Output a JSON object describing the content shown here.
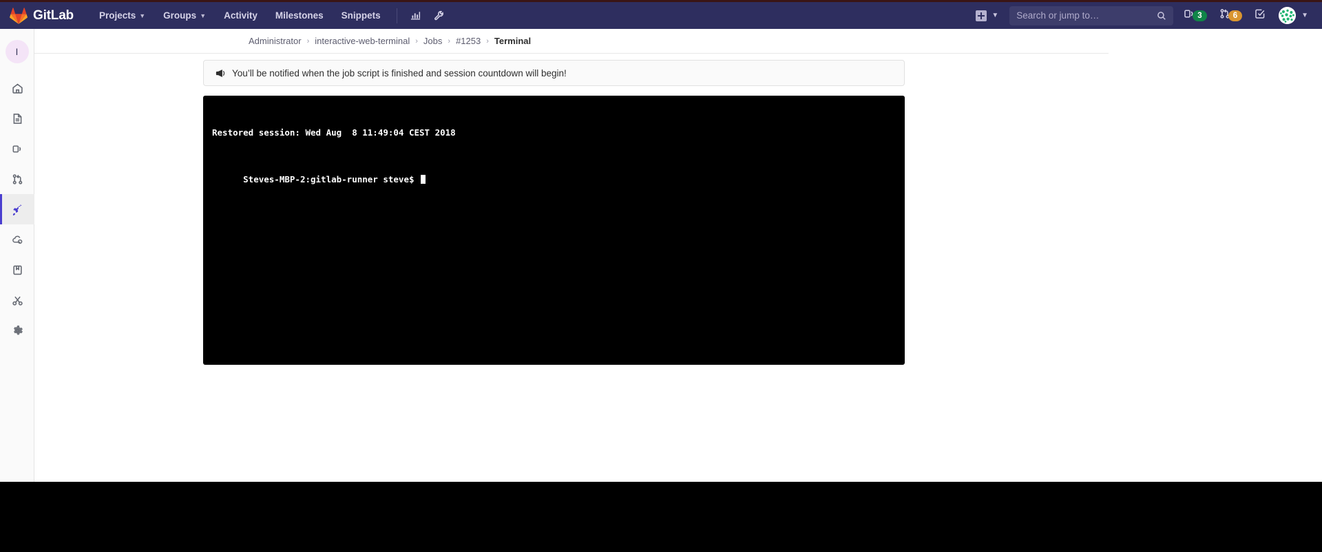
{
  "navbar": {
    "brand": "GitLab",
    "brand_icon": "gitlab-tanuki-logo",
    "items": [
      {
        "label": "Projects",
        "has_caret": true
      },
      {
        "label": "Groups",
        "has_caret": true
      },
      {
        "label": "Activity",
        "has_caret": false
      },
      {
        "label": "Milestones",
        "has_caret": false
      },
      {
        "label": "Snippets",
        "has_caret": false
      }
    ],
    "icon_buttons": [
      {
        "name": "analytics-chart-icon"
      },
      {
        "name": "wrench-icon"
      }
    ],
    "create_new": {
      "icon": "plus-square-icon",
      "caret": "⌄"
    },
    "search": {
      "placeholder": "Search or jump to…",
      "value": "",
      "icon": "search-icon"
    },
    "badges": [
      {
        "icon": "issues-icon",
        "count": "3",
        "color": "#108548"
      },
      {
        "icon": "merge-request-icon",
        "count": "6",
        "color": "#d99530"
      }
    ],
    "todos": {
      "icon": "todos-check-icon"
    },
    "user": {
      "avatar": "user-avatar",
      "caret": "⌄"
    }
  },
  "sidebar": {
    "project_initial": "I",
    "items": [
      {
        "name": "home-icon",
        "active": false
      },
      {
        "name": "issues-doc-icon",
        "active": false
      },
      {
        "name": "repository-icon",
        "active": false
      },
      {
        "name": "merge-requests-icon",
        "active": false
      },
      {
        "name": "ci-cd-rocket-icon",
        "active": true
      },
      {
        "name": "operations-cloud-icon",
        "active": false
      },
      {
        "name": "wiki-book-icon",
        "active": false
      },
      {
        "name": "snippets-scissors-icon",
        "active": false
      },
      {
        "name": "settings-gear-icon",
        "active": false
      }
    ]
  },
  "breadcrumb": {
    "items": [
      "Administrator",
      "interactive-web-terminal",
      "Jobs",
      "#1253"
    ],
    "separator": "›",
    "current": "Terminal"
  },
  "alert": {
    "icon": "megaphone-icon",
    "message": "You’ll be notified when the job script is finished and session countdown will begin!"
  },
  "terminal": {
    "lines": [
      "Restored session: Wed Aug  8 11:49:04 CEST 2018",
      "Steves-MBP-2:gitlab-runner steve$ "
    ],
    "cursor": "block"
  },
  "colors": {
    "navbar_bg": "#2e2e5f",
    "accent": "#4a3ecf",
    "terminal_bg": "#000000",
    "terminal_fg": "#ffffff"
  }
}
